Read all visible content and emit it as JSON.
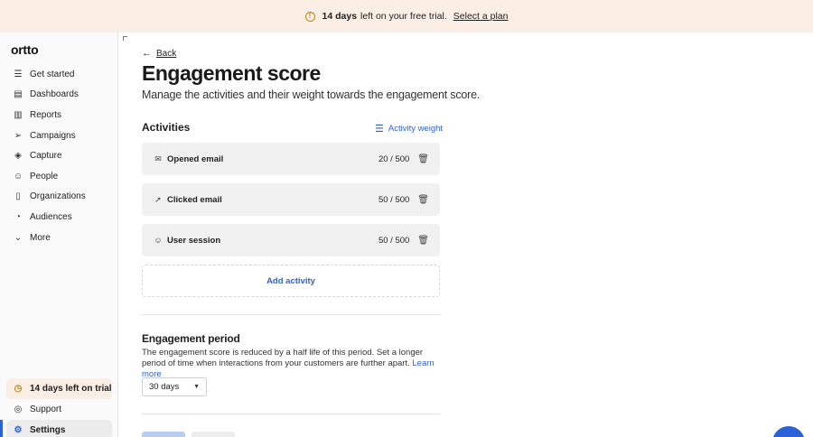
{
  "banner": {
    "days": "14 days",
    "rest": "left on your free trial.",
    "link": "Select a plan"
  },
  "sidebar": {
    "logo": "ortto",
    "items": [
      {
        "label": "Get started",
        "icon": "checklist-icon",
        "glyph": "☰"
      },
      {
        "label": "Dashboards",
        "icon": "dashboard-icon",
        "glyph": "▤"
      },
      {
        "label": "Reports",
        "icon": "bar-chart-icon",
        "glyph": "▥"
      },
      {
        "label": "Campaigns",
        "icon": "send-icon",
        "glyph": "➢"
      },
      {
        "label": "Capture",
        "icon": "capture-icon",
        "glyph": "◈"
      },
      {
        "label": "People",
        "icon": "person-icon",
        "glyph": "☺"
      },
      {
        "label": "Organizations",
        "icon": "building-icon",
        "glyph": "▯"
      },
      {
        "label": "Audiences",
        "icon": "pie-icon",
        "glyph": "◔"
      },
      {
        "label": "More",
        "icon": "chevron-down-icon",
        "glyph": "⌄"
      }
    ],
    "bottom": {
      "trial": "14 days left on trial",
      "support": "Support",
      "settings": "Settings"
    }
  },
  "page": {
    "back": "Back",
    "title": "Engagement score",
    "subtitle": "Manage the activities and their weight towards the engagement score."
  },
  "activities": {
    "title": "Activities",
    "weight_button": "Activity weight",
    "rows": [
      {
        "name": "Opened email",
        "score": "20 / 500",
        "icon": "envelope-icon",
        "glyph": "✉"
      },
      {
        "name": "Clicked email",
        "score": "50 / 500",
        "icon": "cursor-icon",
        "glyph": "➚"
      },
      {
        "name": "User session",
        "score": "50 / 500",
        "icon": "user-icon",
        "glyph": "☺"
      }
    ],
    "add": "Add activity"
  },
  "period": {
    "title": "Engagement period",
    "desc": "The engagement score is reduced by a half life of this period. Set a longer period of time when interactions from your customers are further apart.",
    "learn_more": "Learn more",
    "selected": "30 days"
  },
  "colors": {
    "accent": "#2b62d8",
    "banner_bg": "#fbeee4",
    "warn": "#b9861c"
  }
}
